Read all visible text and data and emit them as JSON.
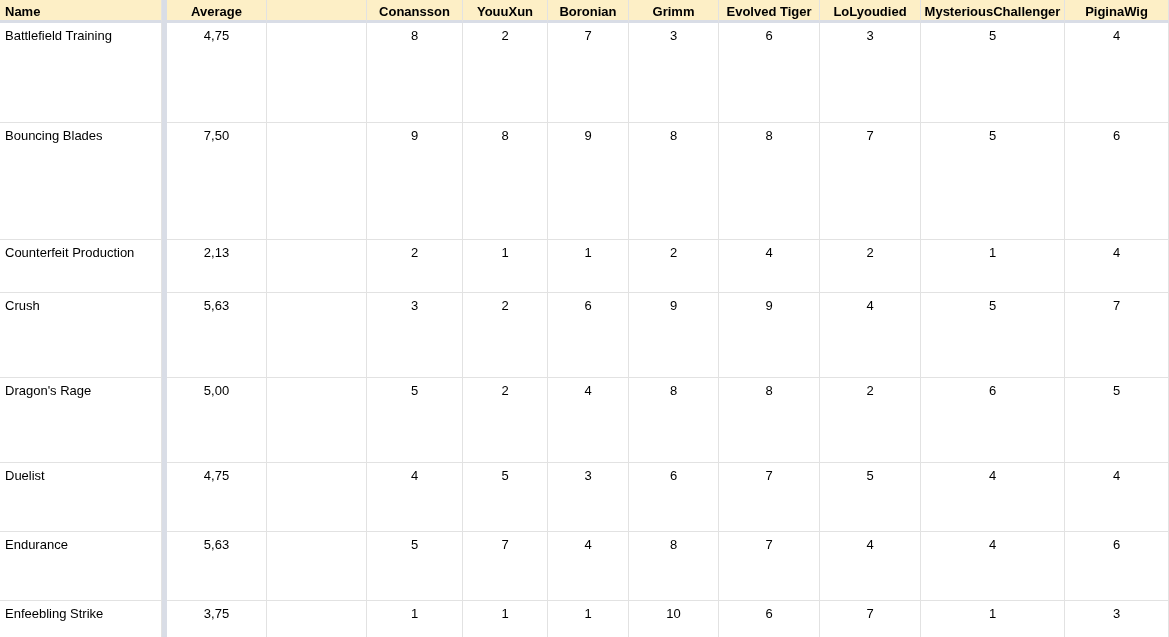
{
  "columns": {
    "name": "Name",
    "average": "Average",
    "players": [
      "Conansson",
      "YouuXun",
      "Boronian",
      "Grimm",
      "Evolved Tiger",
      "LoLyoudied",
      "MysteriousChallenger",
      "PiginaWig"
    ]
  },
  "rows": [
    {
      "name": "Battlefield Training",
      "average": "4,75",
      "scores": [
        "8",
        "2",
        "7",
        "3",
        "6",
        "3",
        "5",
        "4"
      ]
    },
    {
      "name": "Bouncing Blades",
      "average": "7,50",
      "scores": [
        "9",
        "8",
        "9",
        "8",
        "8",
        "7",
        "5",
        "6"
      ]
    },
    {
      "name": "Counterfeit Production",
      "average": "2,13",
      "scores": [
        "2",
        "1",
        "1",
        "2",
        "4",
        "2",
        "1",
        "4"
      ]
    },
    {
      "name": "Crush",
      "average": "5,63",
      "scores": [
        "3",
        "2",
        "6",
        "9",
        "9",
        "4",
        "5",
        "7"
      ]
    },
    {
      "name": "Dragon's Rage",
      "average": "5,00",
      "scores": [
        "5",
        "2",
        "4",
        "8",
        "8",
        "2",
        "6",
        "5"
      ]
    },
    {
      "name": "Duelist",
      "average": "4,75",
      "scores": [
        "4",
        "5",
        "3",
        "6",
        "7",
        "5",
        "4",
        "4"
      ]
    },
    {
      "name": "Endurance",
      "average": "5,63",
      "scores": [
        "5",
        "7",
        "4",
        "8",
        "7",
        "4",
        "4",
        "6"
      ]
    },
    {
      "name": "Enfeebling Strike",
      "average": "3,75",
      "scores": [
        "1",
        "1",
        "1",
        "10",
        "6",
        "7",
        "1",
        "3"
      ]
    }
  ]
}
